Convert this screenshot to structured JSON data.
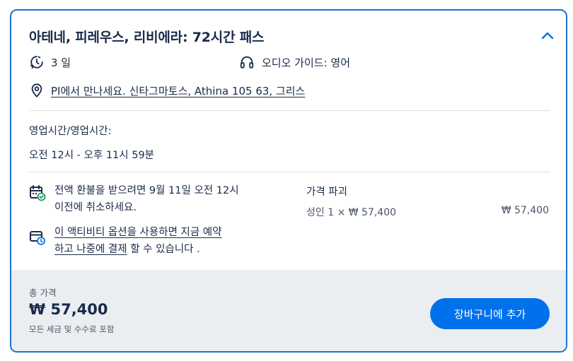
{
  "product": {
    "title": "아테네, 피레우스, 리비에라: 72시간 패스",
    "duration": "3 일",
    "audio_guide": "오디오 가이드: 영어",
    "meeting_point": "PI에서 만나세요. 신타그마토스, Athina 105 63, 그리스"
  },
  "hours": {
    "label": "영업시간/영업시간:",
    "value": "오전 12시 - 오후 11시 59분"
  },
  "cancellation": {
    "line1": "전액 환불을 받으려면 9월 11일 오전 12시",
    "line2": "이전에 취소하세요."
  },
  "reserve": {
    "link_line1": "이 액티비티 옵션을 사용하면 지금 예약",
    "link_line2": "하고 나중에 결제",
    "suffix": " 할 수 있습니다 ."
  },
  "price_breakdown": {
    "title": "가격 파괴",
    "line_label": "성인 1 × ₩ 57,400",
    "line_total": "₩ 57,400"
  },
  "footer": {
    "total_label": "총 가격",
    "total_price": "₩ 57,400",
    "tax_note": "모든 세금 및 수수료 포함",
    "add_to_cart": "장바구니에 추가"
  },
  "colors": {
    "accent": "#0071eb",
    "border": "#1a73d0",
    "text": "#1a2b49",
    "footer_bg": "#ebeef1",
    "success": "#1e9e5a"
  },
  "icons": [
    "chevron-up-icon",
    "clock-icon",
    "headphones-icon",
    "location-pin-icon",
    "calendar-check-icon",
    "pay-later-icon"
  ]
}
